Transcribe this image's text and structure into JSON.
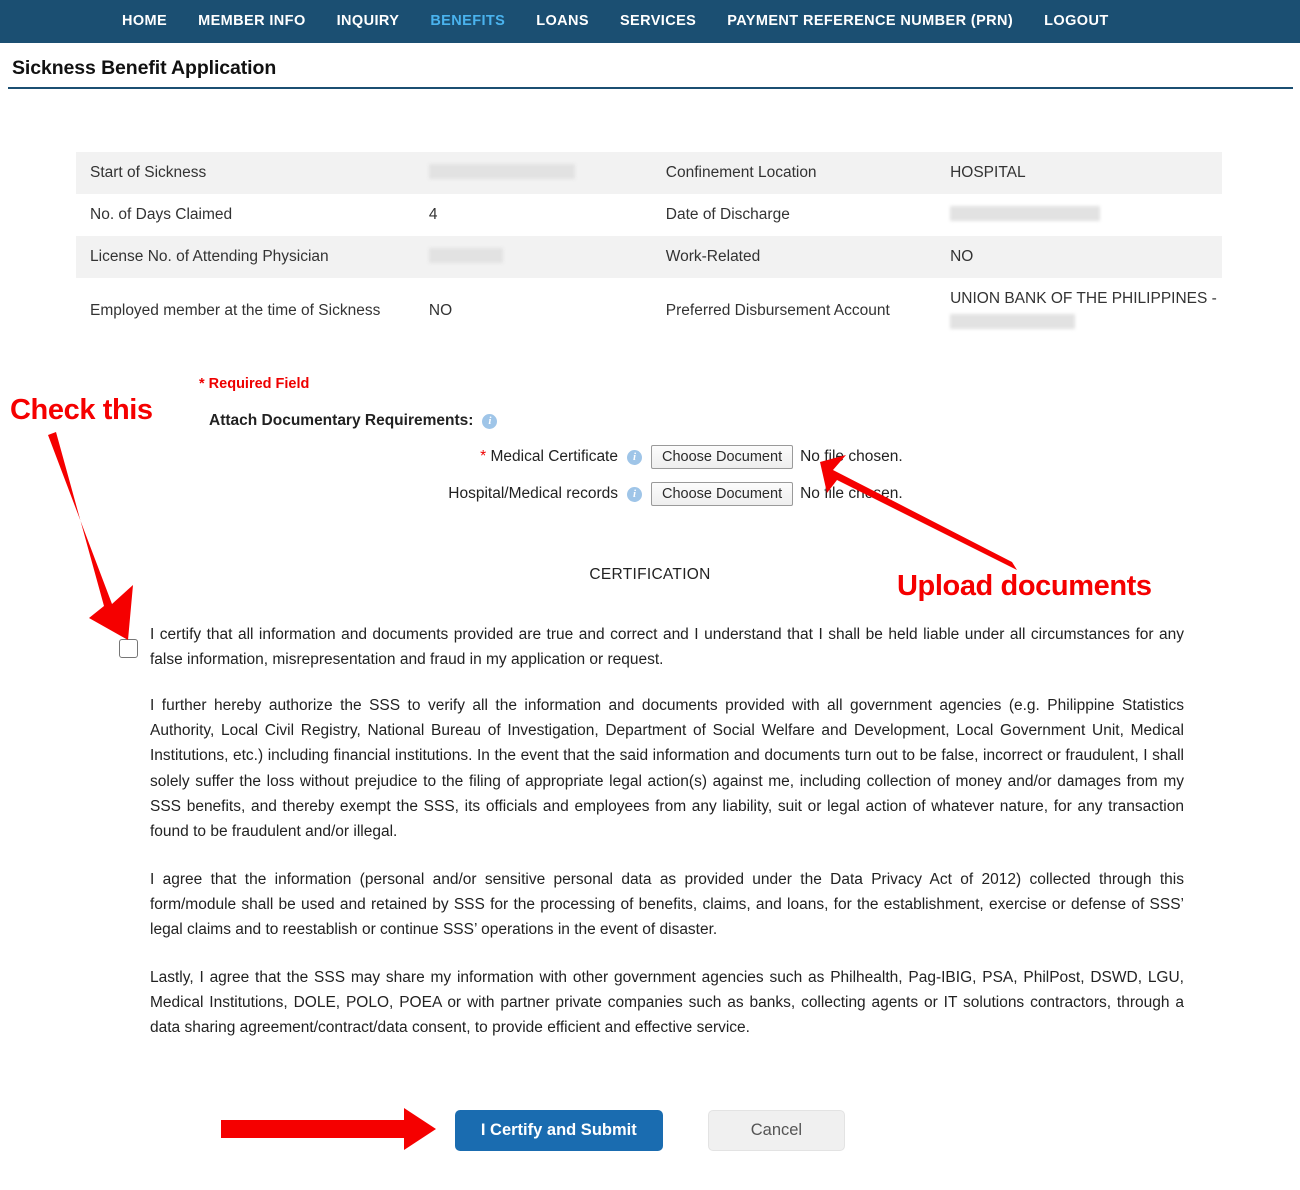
{
  "nav": {
    "items": [
      {
        "label": "HOME",
        "active": false
      },
      {
        "label": "MEMBER INFO",
        "active": false
      },
      {
        "label": "INQUIRY",
        "active": false
      },
      {
        "label": "BENEFITS",
        "active": true
      },
      {
        "label": "LOANS",
        "active": false
      },
      {
        "label": "SERVICES",
        "active": false
      },
      {
        "label": "PAYMENT REFERENCE NUMBER (PRN)",
        "active": false
      },
      {
        "label": "LOGOUT",
        "active": false
      }
    ],
    "active_color": "#4ab3ee",
    "background_color": "#1b4f72"
  },
  "page": {
    "title": "Sickness Benefit Application"
  },
  "info_table": {
    "rows": [
      {
        "left_label": "Start of Sickness",
        "left_value": "",
        "left_redacted": true,
        "right_label": "Confinement Location",
        "right_value": "HOSPITAL",
        "right_redacted": false
      },
      {
        "left_label": "No. of Days Claimed",
        "left_value": "4",
        "left_redacted": false,
        "right_label": "Date of Discharge",
        "right_value": "",
        "right_redacted": true
      },
      {
        "left_label": "License No. of Attending Physician",
        "left_value": "",
        "left_redacted": true,
        "right_label": "Work-Related",
        "right_value": "NO",
        "right_redacted": false
      },
      {
        "left_label": "Employed member at the time of Sickness",
        "left_value": "NO",
        "left_redacted": false,
        "right_label": "Preferred Disbursement Account",
        "right_value": "UNION BANK OF THE PHILIPPINES -",
        "right_redacted": true
      }
    ]
  },
  "form": {
    "required_field_note": "* Required Field",
    "attach_label": "Attach Documentary Requirements:",
    "attachments": [
      {
        "required_star": "*",
        "name": "Medical Certificate",
        "button_label": "Choose Document",
        "status": "No file chosen."
      },
      {
        "required_star": "",
        "name": "Hospital/Medical records",
        "button_label": "Choose Document",
        "status": "No file chosen."
      }
    ]
  },
  "certification": {
    "heading": "CERTIFICATION",
    "checkbox_checked": false,
    "paragraphs": [
      "I certify that all information and documents provided are true and correct and I understand that I shall be held liable under all circumstances for any false information, misrepresentation and fraud in my application or request.",
      "I further hereby authorize the SSS to verify all the information and documents provided with all government agencies (e.g. Philippine Statistics Authority, Local Civil Registry, National Bureau of Investigation, Department of Social Welfare and Development, Local Government Unit, Medical Institutions, etc.) including financial institutions. In the event that the said information and documents turn out to be false, incorrect or fraudulent, I shall solely suffer the loss without prejudice to the filing of appropriate legal action(s) against me, including collection of money and/or damages from my SSS benefits, and thereby exempt the SSS, its officials and employees from any liability, suit or legal action of whatever nature, for any transaction found to be fraudulent and/or illegal.",
      "I agree that the information (personal and/or sensitive personal data as provided under the Data Privacy Act of 2012) collected through this form/module shall be used and retained by SSS for the processing of benefits, claims, and loans, for the establishment, exercise or defense of SSS’ legal claims and to reestablish or continue SSS’ operations in the event of disaster.",
      "Lastly, I agree that the SSS may share my information with other government agencies such as Philhealth, Pag-IBIG, PSA, PhilPost, DSWD, LGU, Medical Institutions, DOLE, POLO, POEA or with partner private companies such as banks, collecting agents or IT solutions contractors, through a data sharing agreement/contract/data consent, to provide efficient and effective service."
    ]
  },
  "actions": {
    "submit_label": "I Certify and Submit",
    "cancel_label": "Cancel",
    "submit_color": "#1a6cb0"
  },
  "annotations": {
    "color": "#f50000",
    "check_this": "Check this",
    "upload_documents": "Upload documents"
  }
}
